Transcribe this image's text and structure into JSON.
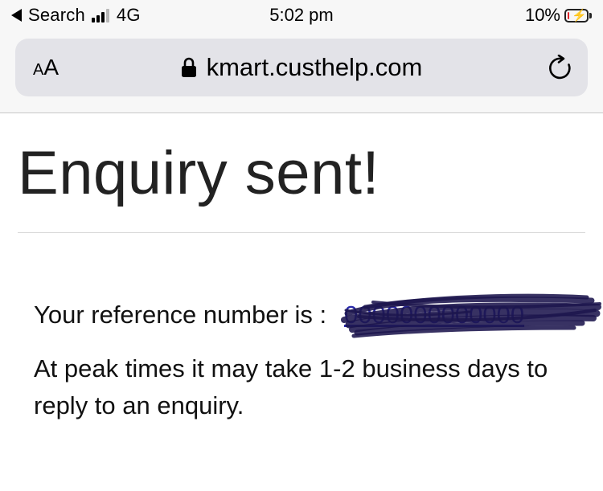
{
  "status_bar": {
    "back_label": "Search",
    "network": "4G",
    "time": "5:02 pm",
    "battery_percent": "10%",
    "battery_level": 0.1,
    "battery_color": "#e0252b"
  },
  "browser": {
    "text_size_button": "AA",
    "url": "kmart.custhelp.com"
  },
  "page": {
    "title": "Enquiry sent!",
    "reference_label": "Your reference number is :",
    "info_text": "At peak times it may take 1-2 business days to reply to an enquiry."
  }
}
